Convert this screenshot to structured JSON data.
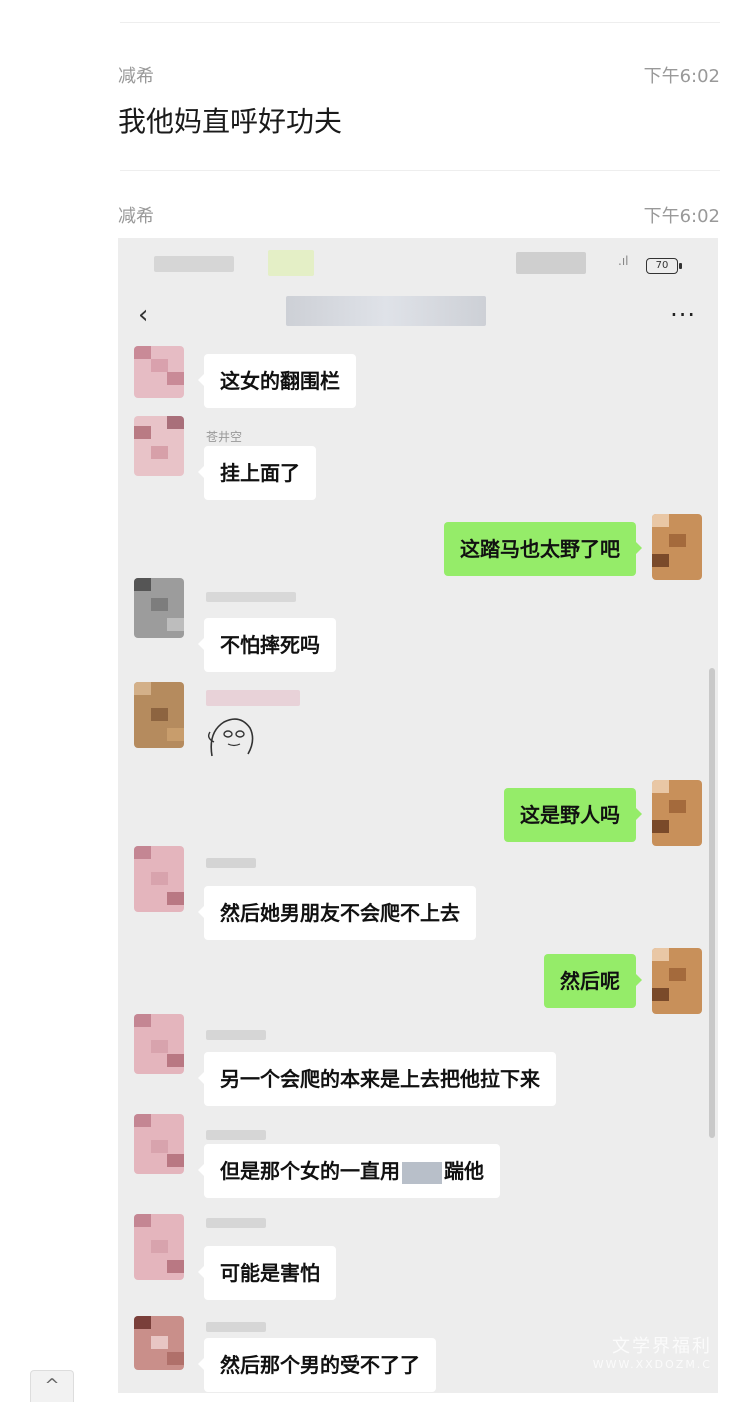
{
  "records": [
    {
      "name": "减希",
      "time": "下午6:02",
      "text": "我他妈直呼好功夫"
    },
    {
      "name": "减希",
      "time": "下午6:02"
    }
  ],
  "screenshot": {
    "battery": "70",
    "back_icon": "chevron-left-icon",
    "more_label": "...",
    "sender_name": "苍井空",
    "messages": [
      {
        "dir": "in",
        "text": "这女的翻围栏"
      },
      {
        "dir": "in",
        "text": "挂上面了"
      },
      {
        "dir": "out",
        "text": "这踏马也太野了吧"
      },
      {
        "dir": "in",
        "text": "不怕摔死吗"
      },
      {
        "dir": "in",
        "sticker": "face-sticker"
      },
      {
        "dir": "out",
        "text": "这是野人吗"
      },
      {
        "dir": "in",
        "text": "然后她男朋友不会爬不上去"
      },
      {
        "dir": "out",
        "text": "然后呢"
      },
      {
        "dir": "in",
        "text": "另一个会爬的本来是上去把他拉下来"
      },
      {
        "dir": "in",
        "text_a": "但是那个女的一直用",
        "text_b": "踹他"
      },
      {
        "dir": "in",
        "text": "可能是害怕"
      },
      {
        "dir": "in",
        "text": "然后那个男的受不了了"
      }
    ],
    "watermark": {
      "line1": "文学界福利",
      "line2": "WWW.XXDOZM.C"
    }
  },
  "scroll_up_icon": "^"
}
